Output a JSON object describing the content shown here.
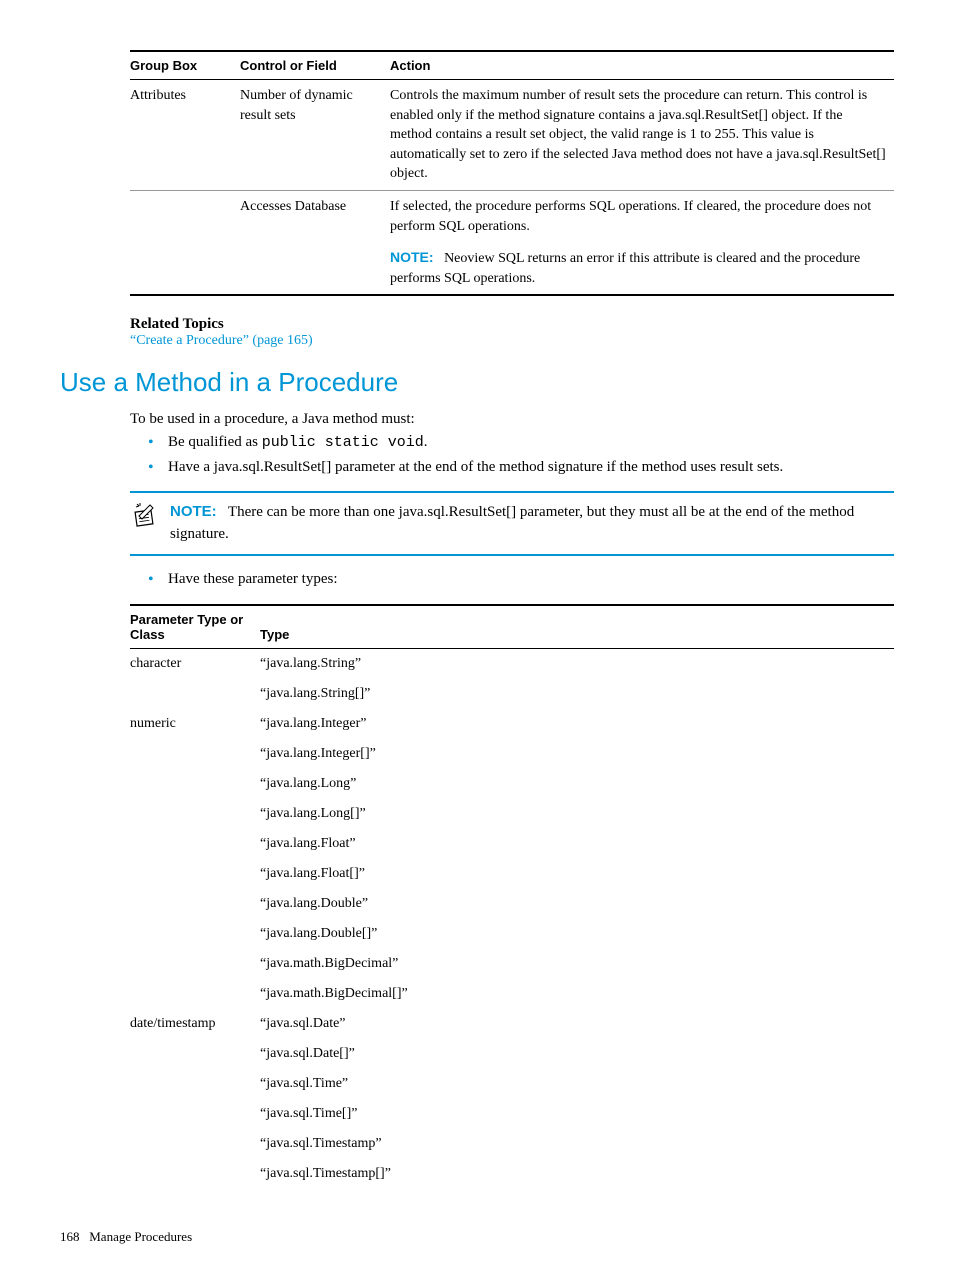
{
  "table1": {
    "headers": [
      "Group Box",
      "Control or Field",
      "Action"
    ],
    "rows": [
      {
        "group": "Attributes",
        "control": "Number of dynamic result sets",
        "action": "Controls the maximum number of result sets the procedure can return. This control is enabled only if the method signature contains a java.sql.ResultSet[] object. If the method contains a result set object, the valid range is 1 to 255. This value is automatically set to zero if the selected Java method does not have a java.sql.ResultSet[] object."
      },
      {
        "group": "",
        "control": "Accesses Database",
        "action": "If selected, the procedure performs SQL operations. If cleared, the procedure does not perform SQL operations."
      },
      {
        "note_label": "NOTE:",
        "note_text": "Neoview SQL returns an error if this attribute is cleared and the procedure performs SQL operations."
      }
    ]
  },
  "related": {
    "heading": "Related Topics",
    "link": "“Create a Procedure” (page 165)"
  },
  "section_heading": "Use a Method in a Procedure",
  "intro_text": "To be used in a procedure, a Java method must:",
  "bullets": {
    "b1_prefix": "Be qualified as ",
    "b1_mono": "public static void",
    "b1_suffix": ".",
    "b2": "Have a java.sql.ResultSet[] parameter at the end of the method signature if the method uses result sets.",
    "b3": "Have these parameter types:"
  },
  "note_box": {
    "label": "NOTE:",
    "text": "There can be more than one java.sql.ResultSet[] parameter, but they must all be at the end of the method signature."
  },
  "table2": {
    "headers": [
      "Parameter Type or Class",
      "Type"
    ],
    "rows": [
      {
        "param": "character",
        "type": "“java.lang.String”"
      },
      {
        "param": "",
        "type": "“java.lang.String[]”"
      },
      {
        "param": "numeric",
        "type": "“java.lang.Integer”"
      },
      {
        "param": "",
        "type": "“java.lang.Integer[]”"
      },
      {
        "param": "",
        "type": "“java.lang.Long”"
      },
      {
        "param": "",
        "type": "“java.lang.Long[]”"
      },
      {
        "param": "",
        "type": "“java.lang.Float”"
      },
      {
        "param": "",
        "type": "“java.lang.Float[]”"
      },
      {
        "param": "",
        "type": "“java.lang.Double”"
      },
      {
        "param": "",
        "type": "“java.lang.Double[]”"
      },
      {
        "param": "",
        "type": "“java.math.BigDecimal”"
      },
      {
        "param": "",
        "type": "“java.math.BigDecimal[]”"
      },
      {
        "param": "date/timestamp",
        "type": "“java.sql.Date”"
      },
      {
        "param": "",
        "type": "“java.sql.Date[]”"
      },
      {
        "param": "",
        "type": "“java.sql.Time”"
      },
      {
        "param": "",
        "type": "“java.sql.Time[]”"
      },
      {
        "param": "",
        "type": "“java.sql.Timestamp”"
      },
      {
        "param": "",
        "type": "“java.sql.Timestamp[]”"
      }
    ]
  },
  "footer": {
    "page": "168",
    "title": "Manage Procedures"
  }
}
